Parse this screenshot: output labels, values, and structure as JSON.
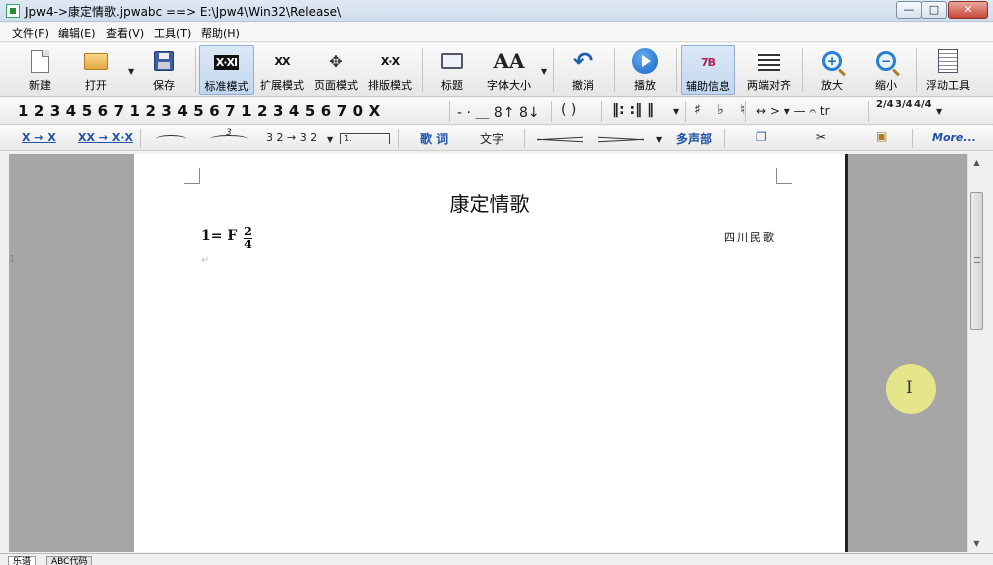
{
  "window": {
    "title": "Jpw4->康定情歌.jpwabc ==> E:\\Jpw4\\Win32\\Release\\",
    "minimize": "—",
    "maximize": "□",
    "close": "✕"
  },
  "menu": [
    "文件(F)",
    "编辑(E)",
    "查看(V)",
    "工具(T)",
    "帮助(H)"
  ],
  "toolbar": {
    "new": "新建",
    "open": "打开",
    "save": "保存",
    "standard_mode": "标准模式",
    "extended_mode": "扩展模式",
    "page_mode": "页面模式",
    "layout_mode": "排版模式",
    "title": "标题",
    "font_size": "字体大小",
    "undo": "撤消",
    "play": "播放",
    "aux_info": "辅助信息",
    "justify": "两端对齐",
    "zoom_in": "放大",
    "zoom_out": "缩小",
    "float_tools": "浮动工具",
    "standard_icon_text": "X·XI",
    "extended_icon_text": "XX",
    "layout_icon_text": "X·X",
    "aux_icon_text": "7B",
    "font_icon_text": "AA"
  },
  "notation_bar": {
    "digits": "1234567123456712345670X",
    "dashes": "- · ＿ 8↑ 8↓",
    "parens": "( )",
    "bars": "‖: :‖ ‖",
    "accidentals": "♯ ♭ ♮",
    "ornaments": "↔ > ▾ — 𝄐 tr",
    "time_sigs": [
      "2/4",
      "3/4",
      "4/4"
    ]
  },
  "format_bar": {
    "conv1": "X → X",
    "conv2": "XX → X·X",
    "triplet": "3",
    "octave": "3 2 → 3 2",
    "volta": "1.",
    "lyrics": "歌 词",
    "text": "文字",
    "multi_voice": "多声部",
    "more": "More..."
  },
  "document": {
    "title": "康定情歌",
    "key": "1= F",
    "time_top": "2",
    "time_bottom": "4",
    "origin": "四川民歌",
    "line_number": "1",
    "paragraph_mark": "↵"
  },
  "tabs": [
    "乐谱",
    "ABC代码"
  ]
}
